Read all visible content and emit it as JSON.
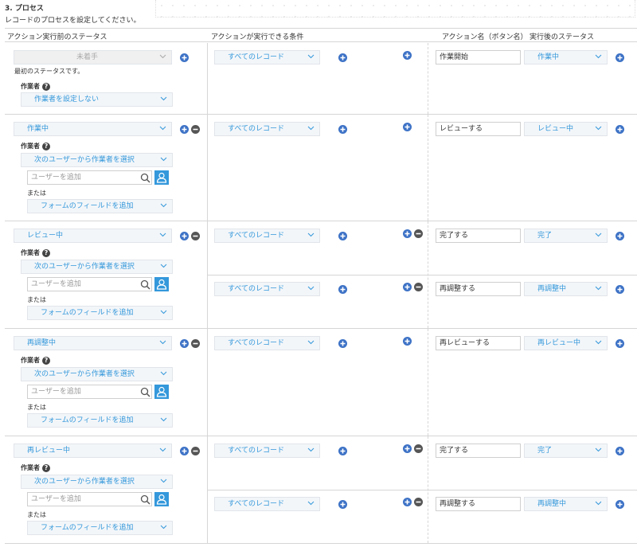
{
  "section": {
    "title": "3. プロセス",
    "description": "レコードのプロセスを設定してください。"
  },
  "headers": {
    "status_before": "アクション実行前のステータス",
    "condition": "アクションが実行できる条件",
    "action_name": "アクション名（ボタン名）",
    "status_after": "実行後のステータス"
  },
  "labels": {
    "assignee": "作業者",
    "or": "または",
    "initial_note": "最初のステータスです。"
  },
  "placeholders": {
    "user": "ユーザーを追加"
  },
  "options": {
    "all_records": "すべてのレコード",
    "no_assignee": "作業者を設定しない",
    "select_from_users": "次のユーザーから作業者を選択",
    "add_form_field": "フォームのフィールドを追加"
  },
  "rows": [
    {
      "status": "未着手",
      "actions": [
        {
          "name": "作業開始",
          "next": "作業中"
        }
      ]
    },
    {
      "status": "作業中",
      "actions": [
        {
          "name": "レビューする",
          "next": "レビュー中"
        }
      ]
    },
    {
      "status": "レビュー中",
      "actions": [
        {
          "name": "完了する",
          "next": "完了"
        },
        {
          "name": "再調整する",
          "next": "再調整中"
        }
      ]
    },
    {
      "status": "再調整中",
      "actions": [
        {
          "name": "再レビューする",
          "next": "再レビュー中"
        }
      ]
    },
    {
      "status": "再レビュー中",
      "actions": [
        {
          "name": "完了する",
          "next": "完了"
        },
        {
          "name": "再調整する",
          "next": "再調整中"
        }
      ]
    }
  ]
}
